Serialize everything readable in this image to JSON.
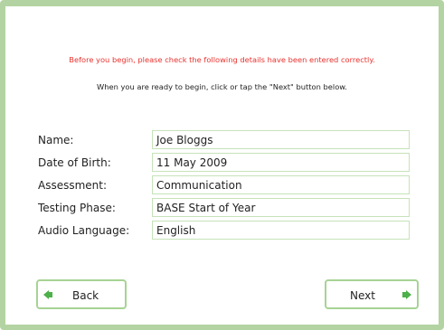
{
  "notice": "Before you begin, please check the following details have been entered correctly.",
  "instruction": "When you are ready to begin, click or tap the \"Next\" button below.",
  "details": [
    {
      "label": "Name:",
      "value": "Joe Bloggs"
    },
    {
      "label": "Date of Birth:",
      "value": "11 May 2009"
    },
    {
      "label": "Assessment:",
      "value": "Communication"
    },
    {
      "label": "Testing Phase:",
      "value": "BASE Start of Year"
    },
    {
      "label": "Audio Language:",
      "value": "English"
    }
  ],
  "buttons": {
    "back_label": "Back",
    "next_label": "Next",
    "back_icon": "arrow-left-icon",
    "next_icon": "arrow-right-icon"
  },
  "colors": {
    "border": "#b3d4a2",
    "notice_text": "#e8322e",
    "arrow": "#4db04a"
  }
}
